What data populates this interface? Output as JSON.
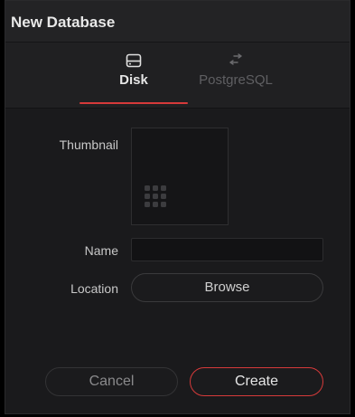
{
  "dialog": {
    "title": "New Database"
  },
  "tabs": [
    {
      "label": "Disk",
      "icon": "disk-icon",
      "selected": true
    },
    {
      "label": "PostgreSQL",
      "icon": "swap-arrows-icon",
      "selected": false
    }
  ],
  "form": {
    "thumbnail_label": "Thumbnail",
    "name_label": "Name",
    "name_value": "",
    "location_label": "Location",
    "browse_label": "Browse"
  },
  "footer": {
    "cancel_label": "Cancel",
    "create_label": "Create"
  },
  "colors": {
    "accent": "#d63a3a",
    "background": "#1a1a1c"
  }
}
